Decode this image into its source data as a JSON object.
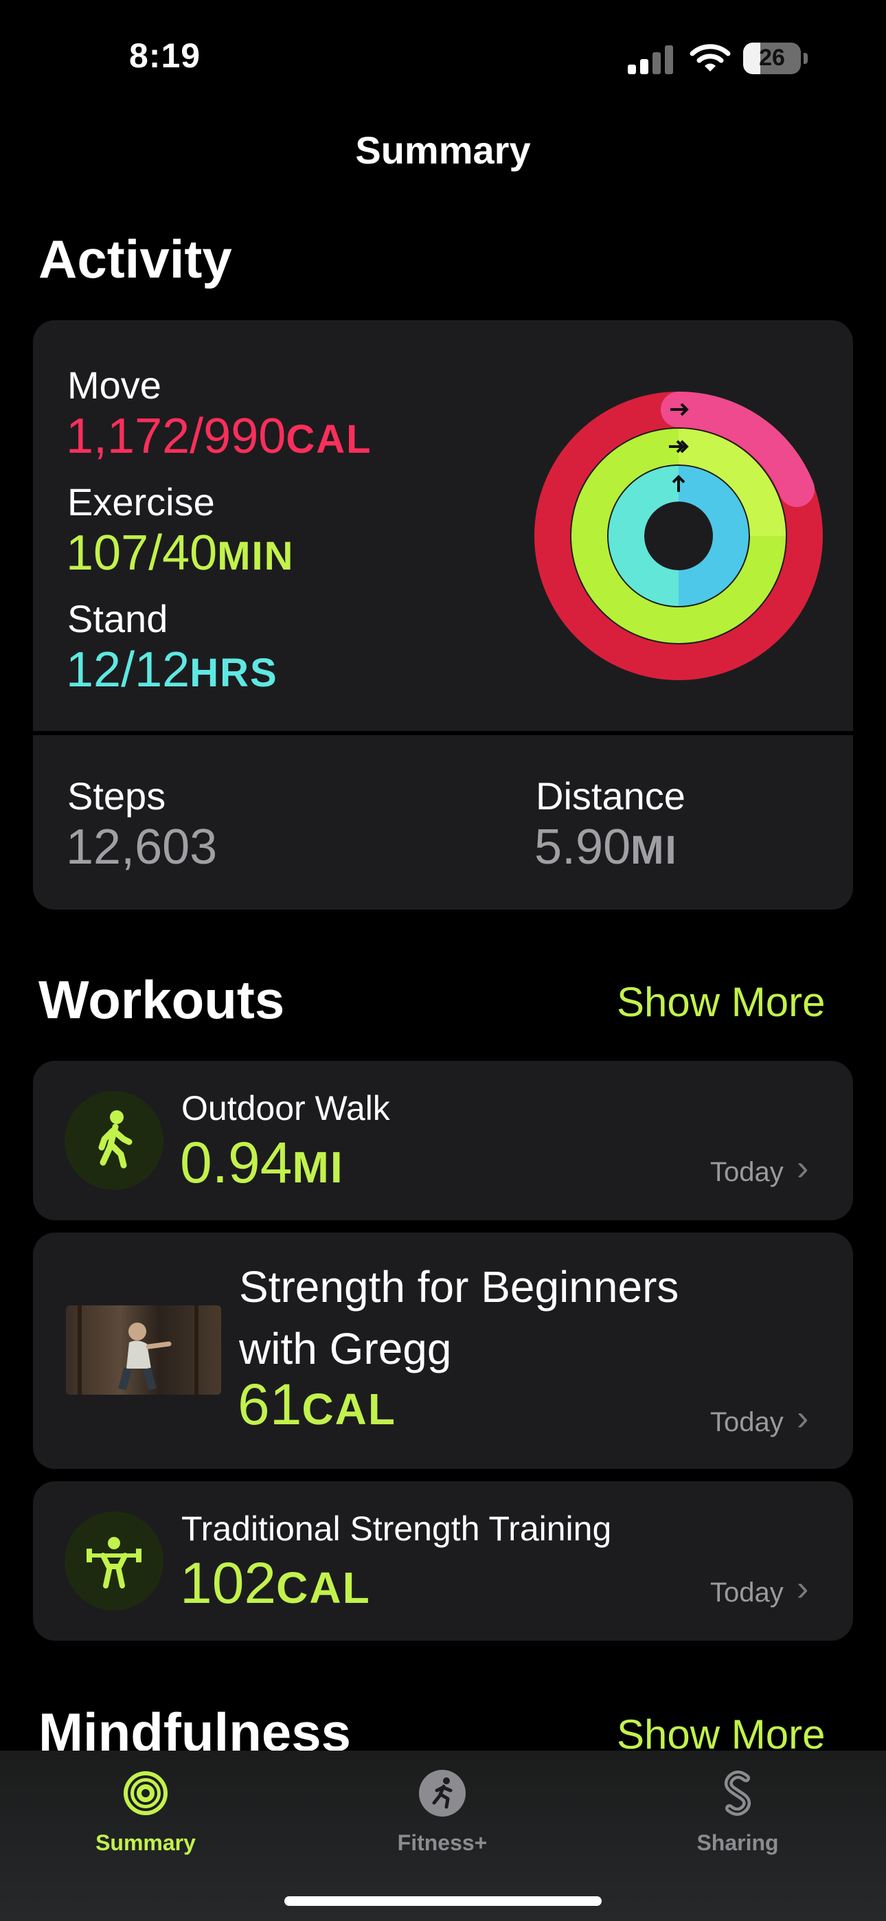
{
  "status_bar": {
    "time": "8:19",
    "battery": "26"
  },
  "nav": {
    "title": "Summary"
  },
  "activity": {
    "title": "Activity",
    "move": {
      "label": "Move",
      "value": "1,172/990",
      "unit": "CAL",
      "color": "#fa2f5b",
      "progress": 1.18
    },
    "exercise": {
      "label": "Exercise",
      "value": "107/40",
      "unit": "MIN",
      "color": "#c2f24c",
      "progress": 2.67
    },
    "stand": {
      "label": "Stand",
      "value": "12/12",
      "unit": "HRS",
      "color": "#5fe8e2",
      "progress": 1.0
    },
    "steps": {
      "label": "Steps",
      "value": "12,603"
    },
    "distance": {
      "label": "Distance",
      "value": "5.90",
      "unit": "MI"
    }
  },
  "workouts": {
    "title": "Workouts",
    "show_more": "Show More",
    "items": [
      {
        "title": "Outdoor Walk",
        "value": "0.94",
        "unit": "MI",
        "date": "Today",
        "icon": "walking-figure-icon"
      },
      {
        "title_line1": "Strength for Beginners",
        "title_line2": "with Gregg",
        "value": "61",
        "unit": "CAL",
        "date": "Today",
        "icon": "workout-thumbnail"
      },
      {
        "title": "Traditional Strength Training",
        "value": "102",
        "unit": "CAL",
        "date": "Today",
        "icon": "weightlifter-icon"
      }
    ]
  },
  "mindfulness": {
    "title": "Mindfulness",
    "show_more": "Show More"
  },
  "tabs": [
    {
      "label": "Summary",
      "icon": "activity-rings-icon",
      "active": true
    },
    {
      "label": "Fitness+",
      "icon": "running-figure-icon",
      "active": false
    },
    {
      "label": "Sharing",
      "icon": "sharing-icon",
      "active": false
    }
  ],
  "colors": {
    "accent": "#c2f24c",
    "card": "#1c1c1e",
    "move": "#fa2f5b",
    "stand": "#5fe8e2"
  }
}
